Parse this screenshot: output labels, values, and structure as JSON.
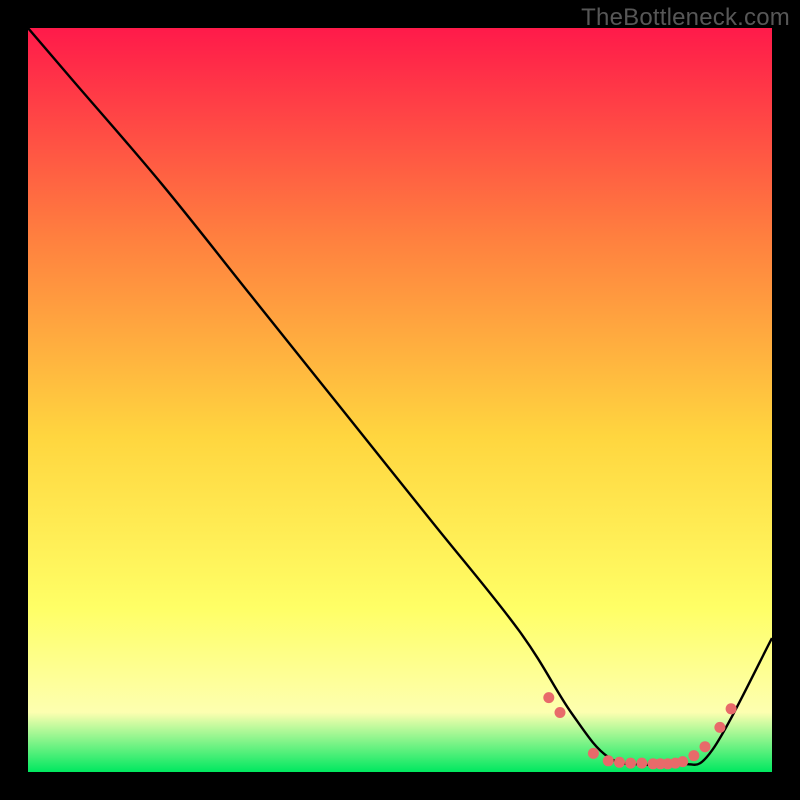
{
  "watermark": "TheBottleneck.com",
  "chart_data": {
    "type": "line",
    "title": "",
    "xlabel": "",
    "ylabel": "",
    "xlim": [
      0,
      100
    ],
    "ylim": [
      0,
      100
    ],
    "gradient_colors": {
      "top": "#ff1a4a",
      "mid1": "#ff7f3f",
      "mid2": "#ffd63f",
      "mid3": "#ffff66",
      "mid4": "#fdffb0",
      "bottom": "#00e860"
    },
    "series": [
      {
        "name": "curve",
        "x": [
          0,
          6,
          18,
          30,
          42,
          54,
          66,
          73,
          78,
          83,
          88,
          92,
          100
        ],
        "y": [
          100,
          93,
          79,
          64,
          49,
          34,
          19,
          8,
          2,
          1,
          1,
          3,
          18
        ]
      }
    ],
    "markers": {
      "name": "points",
      "color": "#e86a6a",
      "radius": 5.5,
      "x": [
        70,
        71.5,
        76,
        78,
        79.5,
        81,
        82.5,
        84,
        85,
        86,
        87,
        88,
        89.5,
        91,
        93,
        94.5
      ],
      "y": [
        10,
        8,
        2.5,
        1.5,
        1.3,
        1.2,
        1.2,
        1.1,
        1.1,
        1.1,
        1.2,
        1.4,
        2.2,
        3.4,
        6,
        8.5
      ]
    }
  }
}
